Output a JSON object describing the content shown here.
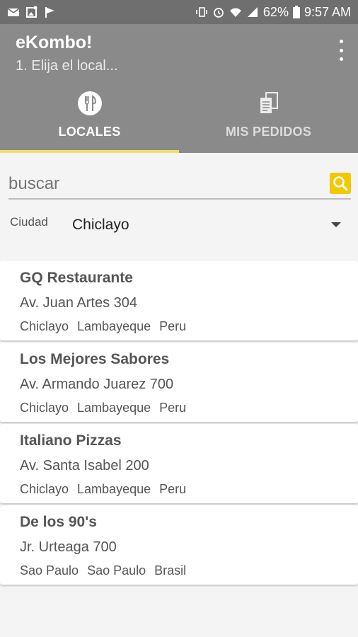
{
  "status_bar": {
    "battery": "62%",
    "time": "9:57 AM"
  },
  "app": {
    "title": "eKombo!",
    "subtitle": "1. Elija el local..."
  },
  "tabs": [
    {
      "label": "LOCALES",
      "icon": "cutlery-icon",
      "active": true
    },
    {
      "label": "MIS PEDIDOS",
      "icon": "documents-icon",
      "active": false
    }
  ],
  "search": {
    "placeholder": "buscar"
  },
  "city": {
    "label": "Ciudad",
    "value": "Chiclayo"
  },
  "restaurants": [
    {
      "name": "GQ Restaurante",
      "address": "Av. Juan Artes 304",
      "city": "Chiclayo",
      "region": "Lambayeque",
      "country": "Peru"
    },
    {
      "name": "Los Mejores Sabores",
      "address": "Av. Armando Juarez 700",
      "city": "Chiclayo",
      "region": "Lambayeque",
      "country": "Peru"
    },
    {
      "name": "Italiano Pizzas",
      "address": "Av. Santa Isabel 200",
      "city": "Chiclayo",
      "region": "Lambayeque",
      "country": "Peru"
    },
    {
      "name": "De los 90's",
      "address": "Jr. Urteaga 700",
      "city": "Sao Paulo",
      "region": "Sao Paulo",
      "country": "Brasil"
    }
  ],
  "colors": {
    "status_bar": "#6f6f6f",
    "app_bar": "#8a8a8a",
    "tab_indicator": "#f2dd68",
    "search_button": "#f2c800"
  }
}
